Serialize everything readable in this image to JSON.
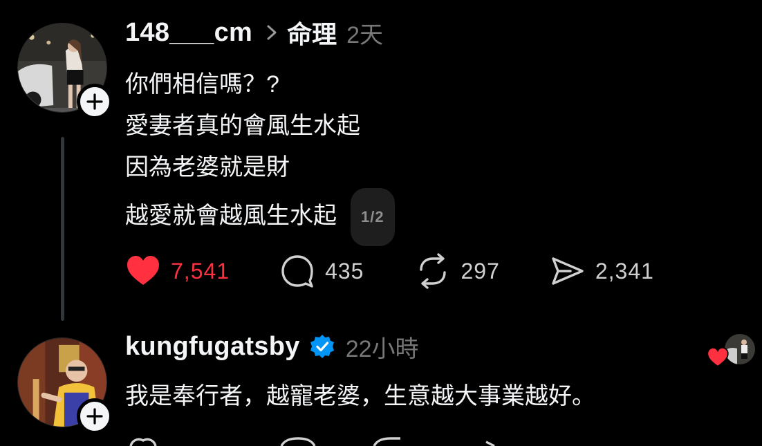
{
  "post": {
    "username": "148___cm",
    "topic": "命理",
    "time": "2天",
    "lines": [
      "你們相信嗎？?",
      "愛妻者真的會風生水起",
      "因為老婆就是財",
      "越愛就會越風生水起"
    ],
    "pager": "1/2",
    "likes": "7,541",
    "comments": "435",
    "reposts": "297",
    "shares": "2,341"
  },
  "reply": {
    "username": "kungfugatsby",
    "time": "22小時",
    "text": "我是奉行者，越寵老婆，生意越大事業越好。"
  },
  "colors": {
    "background": "#000000",
    "text": "#f3f5f7",
    "muted": "#777777",
    "like": "#ff3040",
    "verified": "#0095f6"
  },
  "icons": {
    "like": "heart-filled-icon",
    "comment": "speech-bubble-icon",
    "repost": "repost-arrows-icon",
    "share": "paper-plane-icon",
    "follow": "plus-icon",
    "verified": "verified-badge-icon"
  }
}
